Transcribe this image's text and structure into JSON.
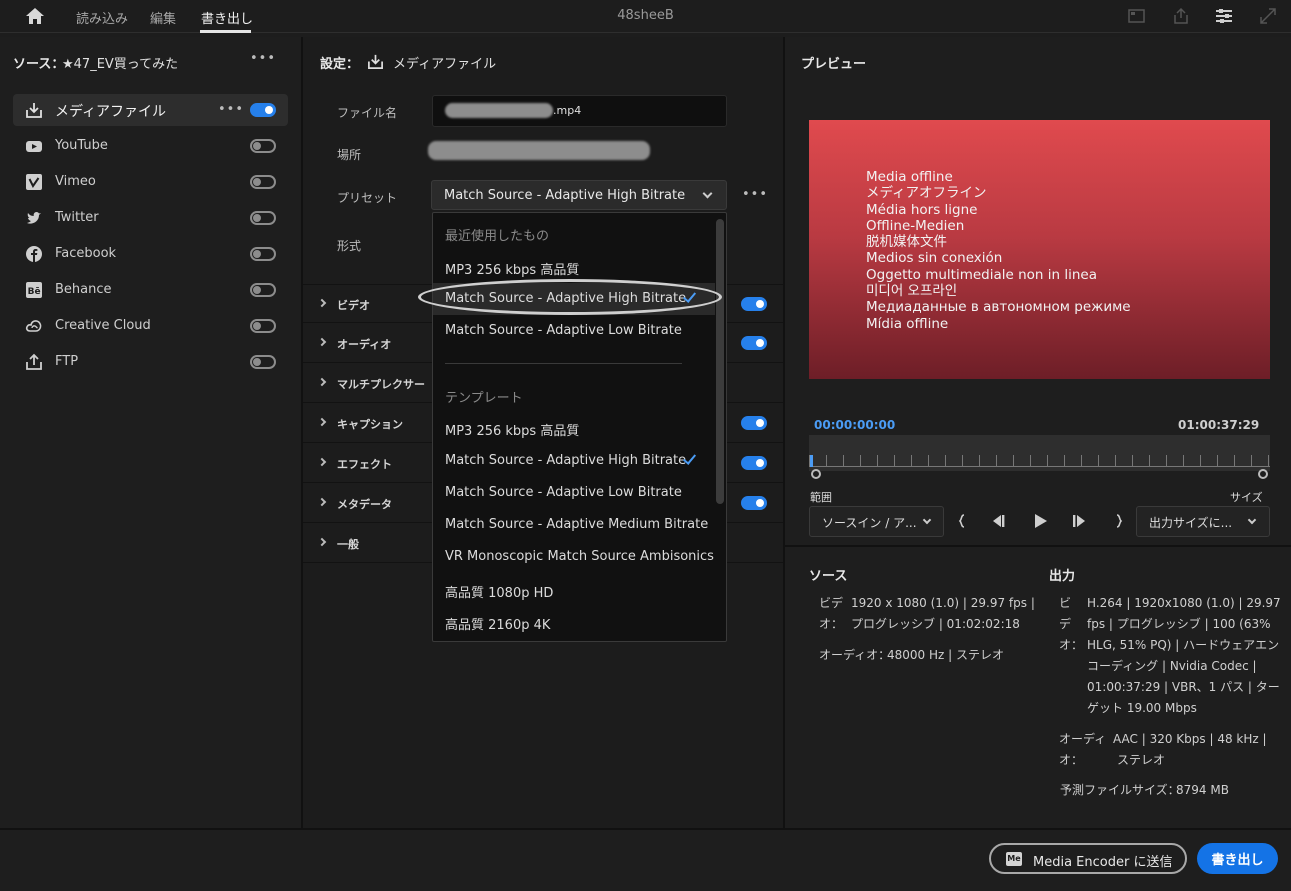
{
  "nav": {
    "tabs": [
      "読み込み",
      "編集",
      "書き出し"
    ],
    "active": "書き出し",
    "project_title": "48sheeB"
  },
  "source": {
    "label": "ソース：",
    "name": "★47_EV買ってみた",
    "destinations": [
      {
        "label": "メディアファイル",
        "icon": "download-icon",
        "enabled": true,
        "selected": true
      },
      {
        "label": "YouTube",
        "icon": "youtube-icon",
        "enabled": false
      },
      {
        "label": "Vimeo",
        "icon": "vimeo-icon",
        "enabled": false
      },
      {
        "label": "Twitter",
        "icon": "twitter-icon",
        "enabled": false
      },
      {
        "label": "Facebook",
        "icon": "facebook-icon",
        "enabled": false
      },
      {
        "label": "Behance",
        "icon": "behance-icon",
        "enabled": false
      },
      {
        "label": "Creative Cloud",
        "icon": "creative-cloud-icon",
        "enabled": false
      },
      {
        "label": "FTP",
        "icon": "upload-icon",
        "enabled": false
      }
    ]
  },
  "settings": {
    "label": "設定：",
    "destination": "メディアファイル",
    "filename_label": "ファイル名",
    "filename_ext": ".mp4",
    "location_label": "場所",
    "preset_label": "プリセット",
    "preset_value": "Match Source - Adaptive High Bitrate",
    "format_label": "形式",
    "sections": [
      {
        "label": "ビデオ",
        "toggle": true
      },
      {
        "label": "オーディオ",
        "toggle": true
      },
      {
        "label": "マルチプレクサー",
        "toggle": null
      },
      {
        "label": "キャプション",
        "toggle": true
      },
      {
        "label": "エフェクト",
        "toggle": true
      },
      {
        "label": "メタデータ",
        "toggle": true
      },
      {
        "label": "一般",
        "toggle": null
      }
    ]
  },
  "dropdown": {
    "recent_header": "最近使用したもの",
    "recent": [
      {
        "label": "MP3 256 kbps 高品質",
        "checked": false
      },
      {
        "label": "Match Source - Adaptive High Bitrate",
        "checked": true
      },
      {
        "label": "Match Source - Adaptive Low Bitrate",
        "checked": false
      }
    ],
    "template_header": "テンプレート",
    "templates": [
      {
        "label": "MP3 256 kbps 高品質",
        "checked": false
      },
      {
        "label": "Match Source - Adaptive High Bitrate",
        "checked": true
      },
      {
        "label": "Match Source - Adaptive Low Bitrate",
        "checked": false
      },
      {
        "label": "Match Source - Adaptive Medium Bitrate",
        "checked": false
      },
      {
        "label": "VR Monoscopic Match Source Ambisonics",
        "checked": false
      },
      {
        "label": "高品質 1080p HD",
        "checked": false
      },
      {
        "label": "高品質 2160p 4K",
        "checked": false
      }
    ]
  },
  "preview": {
    "label": "プレビュー",
    "offline_lines": [
      "Media offline",
      "メディアオフライン",
      "Média hors ligne",
      "Offline-Medien",
      "脱机媒体文件",
      "Medios sin conexión",
      "Oggetto multimediale non in linea",
      "미디어 오프라인",
      "Медиаданные в автономном режиме",
      "Mídia offline"
    ],
    "timecode_start": "00:00:00:00",
    "timecode_end": "01:00:37:29",
    "range_label": "範囲",
    "range_value": "ソースイン / ア...",
    "size_label": "サイズ",
    "size_value": "出力サイズに..."
  },
  "info": {
    "source_header": "ソース",
    "source_video_label_1": "ビデ",
    "source_video_label_2": "オ：",
    "source_video_1": "1920 x 1080 (1.0) | 29.97 fps |",
    "source_video_2": "プログレッシブ | 01:02:02:18",
    "source_audio_label": "オーディオ：",
    "source_audio": "48000 Hz | ステレオ",
    "output_header": "出力",
    "output_video_label": [
      "ビ",
      "デ",
      "オ："
    ],
    "output_video": [
      "H.264 | 1920x1080 (1.0) | 29.97",
      "fps | プログレッシブ | 100 (63%",
      "HLG, 51% PQ) | ハードウェアエン",
      "コーディング | Nvidia Codec |",
      "01:00:37:29 | VBR、1 パス | ター",
      "ゲット 19.00 Mbps"
    ],
    "output_audio_label": [
      "オーディ",
      "オ："
    ],
    "output_audio": [
      "AAC | 320 Kbps | 48 kHz |",
      "ステレオ"
    ],
    "filesize_label": "予測ファイルサイズ：",
    "filesize": "8794 MB"
  },
  "bottom": {
    "me_badge": "Me",
    "media_encoder_label": "Media Encoder に送信",
    "export_label": "書き出し"
  },
  "colors": {
    "accent": "#2680eb",
    "export_button": "#1473e6",
    "check": "#4b9cf5"
  }
}
